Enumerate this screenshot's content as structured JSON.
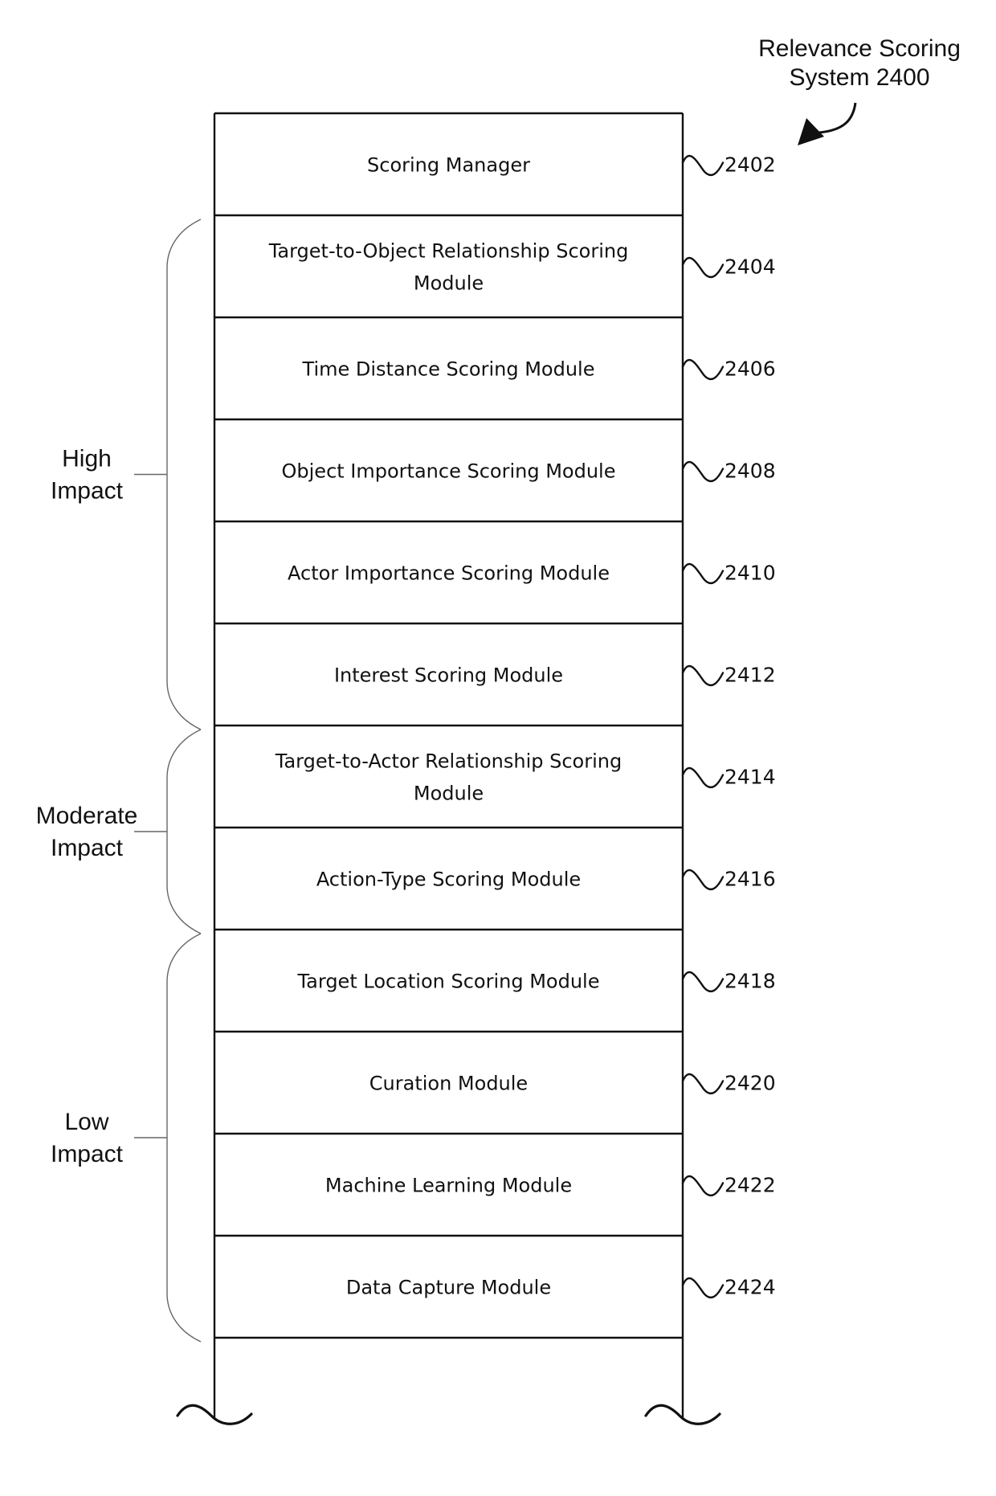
{
  "title": {
    "lines": [
      "Relevance Scoring",
      "System 2400"
    ]
  },
  "modules": [
    {
      "label": [
        "Scoring Manager"
      ],
      "ref": "2402"
    },
    {
      "label": [
        "Target-to-Object Relationship Scoring",
        "Module"
      ],
      "ref": "2404"
    },
    {
      "label": [
        "Time Distance Scoring Module"
      ],
      "ref": "2406"
    },
    {
      "label": [
        "Object Importance Scoring Module"
      ],
      "ref": "2408"
    },
    {
      "label": [
        "Actor Importance Scoring Module"
      ],
      "ref": "2410"
    },
    {
      "label": [
        "Interest Scoring Module"
      ],
      "ref": "2412"
    },
    {
      "label": [
        "Target-to-Actor Relationship Scoring",
        "Module"
      ],
      "ref": "2414"
    },
    {
      "label": [
        "Action-Type Scoring Module"
      ],
      "ref": "2416"
    },
    {
      "label": [
        "Target Location Scoring Module"
      ],
      "ref": "2418"
    },
    {
      "label": [
        "Curation Module"
      ],
      "ref": "2420"
    },
    {
      "label": [
        "Machine Learning Module"
      ],
      "ref": "2422"
    },
    {
      "label": [
        "Data Capture Module"
      ],
      "ref": "2424"
    }
  ],
  "impact_groups": [
    {
      "label": [
        "High",
        "Impact"
      ],
      "first_module": 1,
      "last_module": 5
    },
    {
      "label": [
        "Moderate",
        "Impact"
      ],
      "first_module": 6,
      "last_module": 7
    },
    {
      "label": [
        "Low",
        "Impact"
      ],
      "first_module": 8,
      "last_module": 11
    }
  ],
  "colors": {
    "line": "#111111",
    "brace": "#666666",
    "background": "#ffffff"
  }
}
